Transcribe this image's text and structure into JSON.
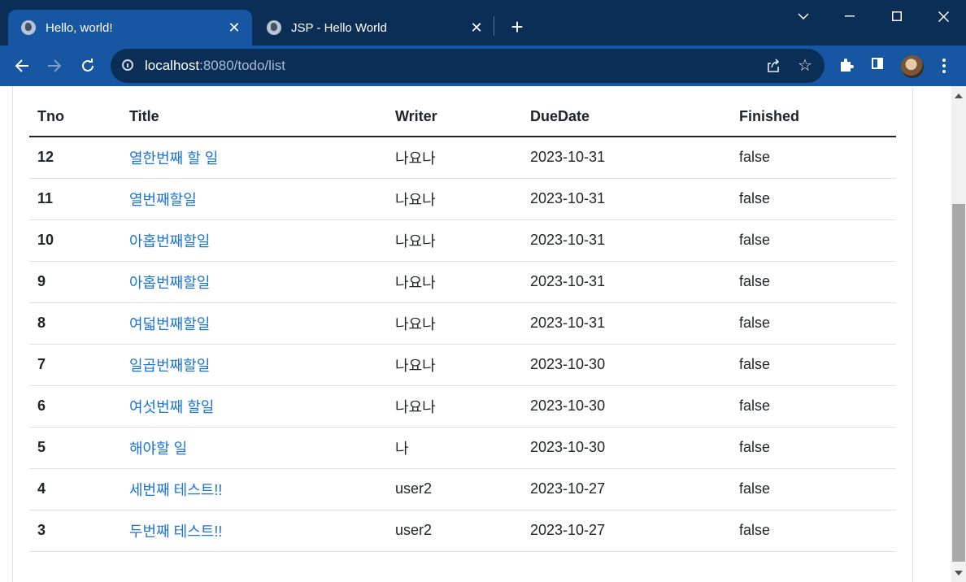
{
  "browser": {
    "tabs": [
      {
        "title": "Hello, world!",
        "active": true
      },
      {
        "title": "JSP - Hello World",
        "active": false
      }
    ],
    "new_tab_label": "+",
    "address": {
      "host": "localhost",
      "rest": ":8080/todo/list"
    },
    "colors": {
      "titlebar": "#0b2e57",
      "toolbar": "#1656a3",
      "omnibox": "#0b2e57"
    }
  },
  "table": {
    "headers": {
      "tno": "Tno",
      "title": "Title",
      "writer": "Writer",
      "duedate": "DueDate",
      "finished": "Finished"
    },
    "rows": [
      {
        "tno": "12",
        "title": "열한번째 할 일",
        "writer": "나요나",
        "duedate": "2023-10-31",
        "finished": "false"
      },
      {
        "tno": "11",
        "title": "열번째할일",
        "writer": "나요나",
        "duedate": "2023-10-31",
        "finished": "false"
      },
      {
        "tno": "10",
        "title": "아홉번째할일",
        "writer": "나요나",
        "duedate": "2023-10-31",
        "finished": "false"
      },
      {
        "tno": "9",
        "title": "아홉번째할일",
        "writer": "나요나",
        "duedate": "2023-10-31",
        "finished": "false"
      },
      {
        "tno": "8",
        "title": "여덟번째할일",
        "writer": "나요나",
        "duedate": "2023-10-31",
        "finished": "false"
      },
      {
        "tno": "7",
        "title": "일곱번째할일",
        "writer": "나요나",
        "duedate": "2023-10-30",
        "finished": "false"
      },
      {
        "tno": "6",
        "title": "여섯번째 할일",
        "writer": "나요나",
        "duedate": "2023-10-30",
        "finished": "false"
      },
      {
        "tno": "5",
        "title": "해야할 일",
        "writer": "나",
        "duedate": "2023-10-30",
        "finished": "false"
      },
      {
        "tno": "4",
        "title": "세번째 테스트!!",
        "writer": "user2",
        "duedate": "2023-10-27",
        "finished": "false"
      },
      {
        "tno": "3",
        "title": "두번째 테스트!!",
        "writer": "user2",
        "duedate": "2023-10-27",
        "finished": "false"
      }
    ],
    "link_color": "#1a73d9"
  }
}
